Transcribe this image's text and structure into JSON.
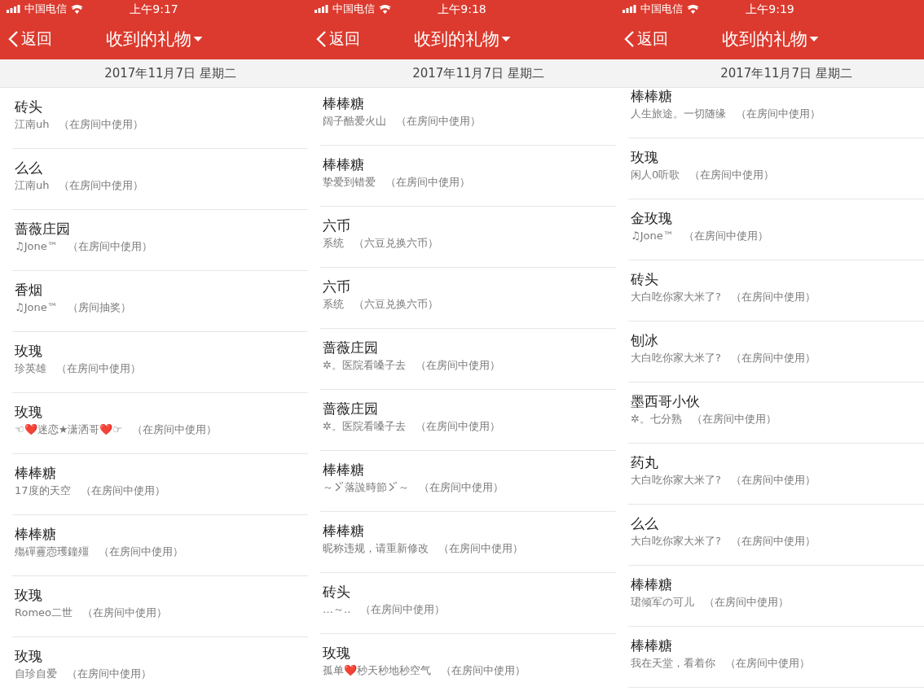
{
  "screens": [
    {
      "status_bar": {
        "carrier": "中国电信",
        "time": "上午9:17"
      },
      "nav": {
        "back": "返回",
        "title": "收到的礼物"
      },
      "date_header": "2017年11月7日 星期二",
      "rows": [
        {
          "gift": "砖头",
          "sender": "江南uh",
          "source": "（在房间中使用）"
        },
        {
          "gift": "么么",
          "sender": "江南uh",
          "source": "（在房间中使用）"
        },
        {
          "gift": "蔷薇庄园",
          "sender": "♫Jone™",
          "source": "（在房间中使用）"
        },
        {
          "gift": "香烟",
          "sender": "♫Jone™",
          "source": "（房间抽奖）"
        },
        {
          "gift": "玫瑰",
          "sender": "珍英雄",
          "source": "（在房间中使用）"
        },
        {
          "gift": "玫瑰",
          "sender": "☜❤️迷恋★潇洒哥❤️☞",
          "source": "（在房间中使用）"
        },
        {
          "gift": "棒棒糖",
          "sender": "17度的天空",
          "source": "（在房间中使用）"
        },
        {
          "gift": "棒棒糖",
          "sender": "殤磾霻悫瓁鐘殭",
          "source": "（在房间中使用）"
        },
        {
          "gift": "玫瑰",
          "sender": "Romeo二世",
          "source": "（在房间中使用）"
        },
        {
          "gift": "玫瑰",
          "sender": "自珍自爱",
          "source": "（在房间中使用）"
        }
      ]
    },
    {
      "status_bar": {
        "carrier": "中国电信",
        "time": "上午9:18"
      },
      "nav": {
        "back": "返回",
        "title": "收到的礼物"
      },
      "date_header": "2017年11月7日 星期二",
      "rows": [
        {
          "gift": "棒棒糖",
          "sender": "阔子酷爱火山",
          "source": "（在房间中使用）"
        },
        {
          "gift": "棒棒糖",
          "sender": "挚爱到错爱",
          "source": "（在房间中使用）"
        },
        {
          "gift": "六币",
          "sender": "系统",
          "source": "（六豆兑换六币）"
        },
        {
          "gift": "六币",
          "sender": "系统",
          "source": "（六豆兑换六币）"
        },
        {
          "gift": "蔷薇庄园",
          "sender": "✲。医院看嗓子去",
          "source": "（在房间中使用）"
        },
        {
          "gift": "蔷薇庄园",
          "sender": "✲。医院看嗓子去",
          "source": "（在房间中使用）"
        },
        {
          "gift": "棒棒糖",
          "sender_parts": [
            {
              "kind": "text",
              "text": "～"
            },
            {
              "kind": "mark"
            },
            {
              "kind": "text",
              "text": "落詤時節"
            },
            {
              "kind": "mark"
            },
            {
              "kind": "text",
              "text": "～"
            }
          ],
          "source": "（在房间中使用）"
        },
        {
          "gift": "棒棒糖",
          "sender": "昵称违规，请重新修改",
          "source": "（在房间中使用）"
        },
        {
          "gift": "砖头",
          "sender": "…～..",
          "source": "（在房间中使用）"
        },
        {
          "gift": "玫瑰",
          "sender": "孤单❤️秒天秒地秒空气",
          "source": "（在房间中使用）"
        }
      ]
    },
    {
      "status_bar": {
        "carrier": "中国电信",
        "time": "上午9:19"
      },
      "nav": {
        "back": "返回",
        "title": "收到的礼物"
      },
      "date_header": "2017年11月7日 星期二",
      "rows": [
        {
          "gift": "棒棒糖",
          "sender": "人生旅途。一切随缘",
          "source": "（在房间中使用）"
        },
        {
          "gift": "玫瑰",
          "sender": "闲人0听歌",
          "source": "（在房间中使用）"
        },
        {
          "gift": "金玫瑰",
          "sender": "♫Jone™",
          "source": "（在房间中使用）"
        },
        {
          "gift": "砖头",
          "sender": "大白吃你家大米了?",
          "source": "（在房间中使用）"
        },
        {
          "gift": "刨冰",
          "sender": "大白吃你家大米了?",
          "source": "（在房间中使用）"
        },
        {
          "gift": "墨西哥小伙",
          "sender": "✲。七分熟",
          "source": "（在房间中使用）"
        },
        {
          "gift": "药丸",
          "sender": "大白吃你家大米了?",
          "source": "（在房间中使用）"
        },
        {
          "gift": "么么",
          "sender": "大白吃你家大米了?",
          "source": "（在房间中使用）"
        },
        {
          "gift": "棒棒糖",
          "sender": "珺倾军の可儿",
          "source": "（在房间中使用）"
        },
        {
          "gift": "棒棒糖",
          "sender": "我在天堂，看着你",
          "source": "（在房间中使用）"
        }
      ]
    }
  ]
}
